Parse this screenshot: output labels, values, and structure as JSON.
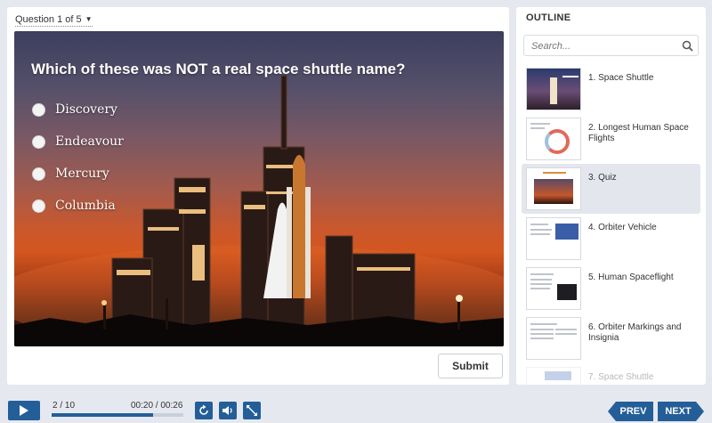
{
  "question_counter": "Question 1 of 5",
  "quiz": {
    "question": "Which of these was NOT a real space shuttle name?",
    "choices": [
      {
        "label": "Discovery"
      },
      {
        "label": "Endeavour"
      },
      {
        "label": "Mercury"
      },
      {
        "label": "Columbia"
      }
    ],
    "submit_label": "Submit"
  },
  "outline": {
    "heading": "OUTLINE",
    "search_placeholder": "Search...",
    "items": [
      {
        "label": "1. Space Shuttle"
      },
      {
        "label": "2. Longest Human Space Flights"
      },
      {
        "label": "3. Quiz",
        "active": true
      },
      {
        "label": "4. Orbiter Vehicle"
      },
      {
        "label": "5. Human Spaceflight"
      },
      {
        "label": "6. Orbiter Markings and Insignia"
      },
      {
        "label": "7. Space Shuttle"
      }
    ]
  },
  "player": {
    "slide_count": "2 / 10",
    "time": "00:20 / 00:26",
    "progress": 0.77,
    "prev_label": "PREV",
    "next_label": "NEXT"
  },
  "colors": {
    "accent": "#245e98",
    "active_item": "#e3e6ec"
  }
}
